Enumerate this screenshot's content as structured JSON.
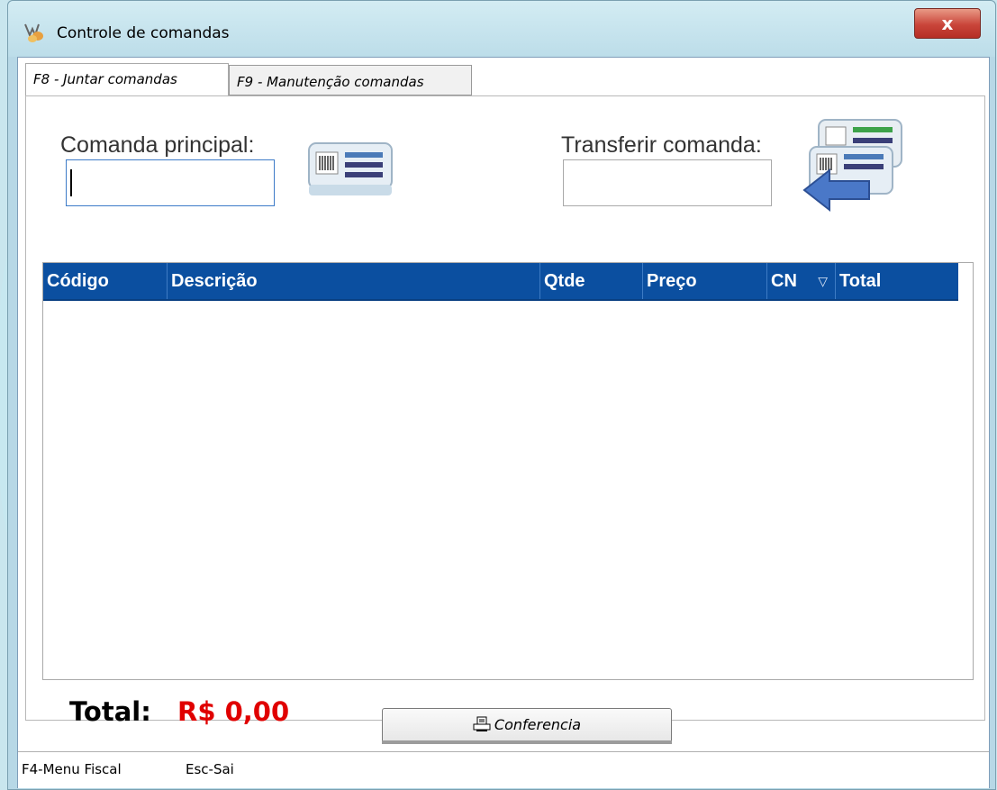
{
  "window": {
    "title": "Controle de comandas",
    "close_label": "x"
  },
  "tabs": [
    {
      "label": "F8 - Juntar comandas",
      "active": true
    },
    {
      "label": "F9 - Manutenção comandas",
      "active": false
    }
  ],
  "form": {
    "principal_label": "Comanda principal:",
    "principal_value": "",
    "transferir_label": "Transferir comanda:",
    "transferir_value": ""
  },
  "icons": {
    "principal": "comanda-card-icon",
    "transferir": "transfer-comanda-icon",
    "print": "printer-icon",
    "sort": "sort-down-icon"
  },
  "grid": {
    "columns": [
      "Código",
      "Descrição",
      "Qtde",
      "Preço",
      "CN",
      "Total"
    ],
    "sort_glyph": "▽",
    "rows": []
  },
  "totals": {
    "label": "Total:",
    "value": "R$ 0,00"
  },
  "buttons": {
    "conferencia": "Conferencia"
  },
  "statusbar": {
    "menu_fiscal": "F4-Menu Fiscal",
    "sair": "Esc-Sai"
  },
  "colors": {
    "header_blue": "#0b4fa0",
    "total_red": "#e00000",
    "close_red": "#c9453a"
  }
}
